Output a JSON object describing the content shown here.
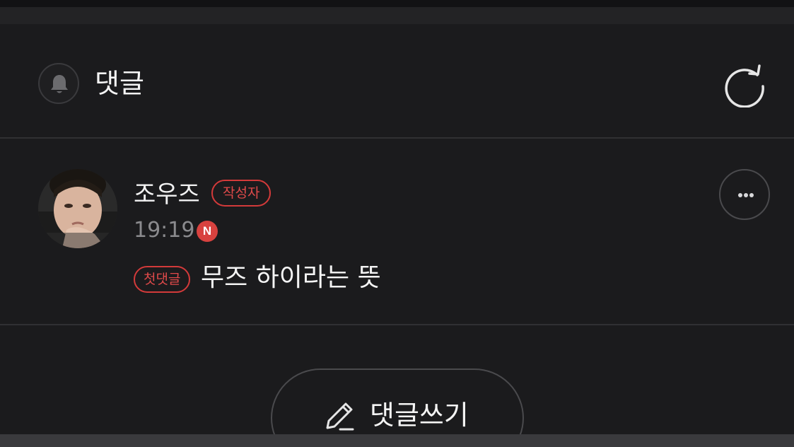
{
  "header": {
    "title": "댓글",
    "icons": {
      "notification": "bell-icon",
      "refresh": "refresh-icon"
    }
  },
  "comment": {
    "author": "조우즈",
    "author_badge": "작성자",
    "time": "19:19",
    "platform_badge": "N",
    "first_comment_badge": "첫댓글",
    "text": "무즈 하이라는 뜻",
    "more_icon": "more-dots-icon"
  },
  "composer": {
    "label": "댓글쓰기",
    "icon": "pencil-icon"
  },
  "colors": {
    "background": "#1b1b1d",
    "accent": "#d33a3a",
    "text": "#f4f4f4",
    "muted": "#8a8a8d"
  }
}
